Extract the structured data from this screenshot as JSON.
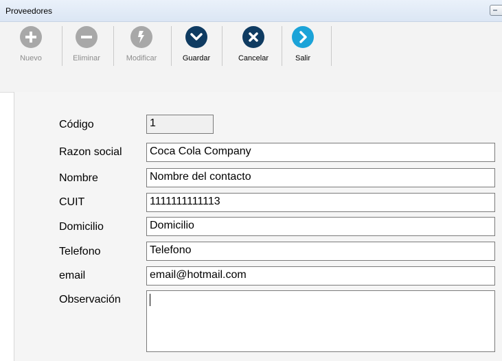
{
  "window": {
    "title": "Proveedores"
  },
  "toolbar": {
    "buttons": [
      {
        "label": "Nuevo",
        "icon": "plus-icon",
        "enabled": false,
        "color": "#a8a8a8"
      },
      {
        "label": "Eliminar",
        "icon": "minus-icon",
        "enabled": false,
        "color": "#a8a8a8"
      },
      {
        "label": "Modificar",
        "icon": "edit-icon",
        "enabled": false,
        "color": "#a8a8a8"
      },
      {
        "label": "Guardar",
        "icon": "chevron-down-icon",
        "enabled": true,
        "color": "#0f3b61"
      },
      {
        "label": "Cancelar",
        "icon": "close-icon",
        "enabled": true,
        "color": "#0f3b61"
      },
      {
        "label": "Salir",
        "icon": "chevron-right-icon",
        "enabled": true,
        "color": "#1ba3d8"
      }
    ]
  },
  "form": {
    "codigo": {
      "label": "Código",
      "value": "1"
    },
    "razon_social": {
      "label": "Razon social",
      "value": "Coca Cola Company"
    },
    "nombre": {
      "label": "Nombre",
      "value": "Nombre del contacto"
    },
    "cuit": {
      "label": "CUIT",
      "value": "1111111111113"
    },
    "domicilio": {
      "label": "Domicilio",
      "value": "Domicilio"
    },
    "telefono": {
      "label": "Telefono",
      "value": "Telefono"
    },
    "email": {
      "label": "email",
      "value": "email@hotmail.com"
    },
    "observacion": {
      "label": "Observación",
      "value": ""
    }
  }
}
